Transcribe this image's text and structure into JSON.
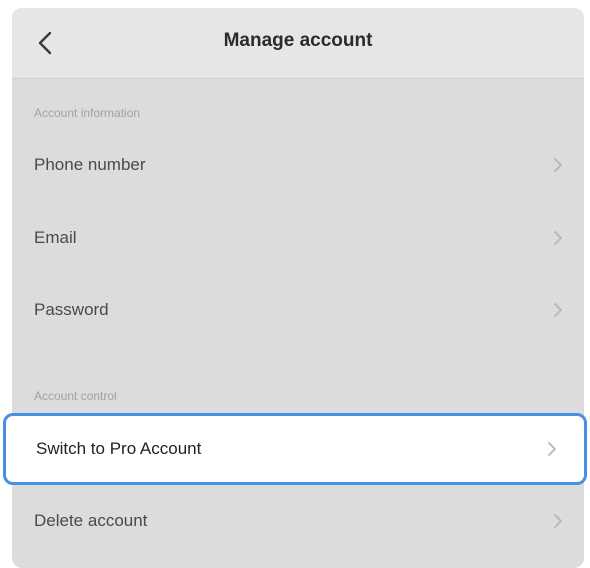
{
  "header": {
    "title": "Manage account",
    "back_icon": "chevron-left-icon"
  },
  "sections": {
    "account_information": {
      "label": "Account information",
      "items": [
        {
          "label": "Phone number"
        },
        {
          "label": "Email"
        },
        {
          "label": "Password"
        }
      ]
    },
    "account_control": {
      "label": "Account control",
      "items": [
        {
          "label": "Switch to Pro Account"
        },
        {
          "label": "Delete account"
        }
      ]
    }
  },
  "colors": {
    "highlight_border": "#4a90e2",
    "dimmed_background": "#dcdcdc"
  }
}
